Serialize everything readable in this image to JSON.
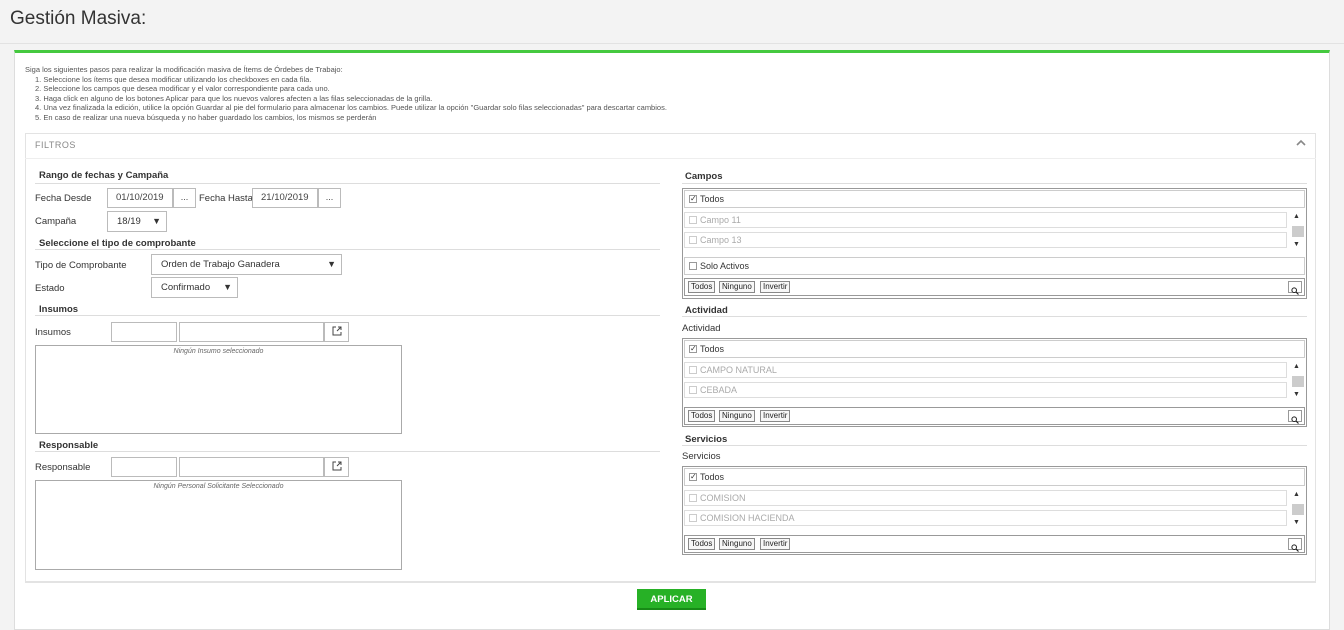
{
  "page": {
    "title": "Gestión Masiva:"
  },
  "instructions": {
    "intro": "Siga los siguientes pasos para realizar la modificación masiva de Ítems de Órdebes de Trabajo:",
    "steps": [
      "1. Seleccione los ítems que desea modificar utilizando los checkboxes en cada fila.",
      "2. Seleccione los campos que desea modificar y el valor correspondiente para cada uno.",
      "3. Haga click en alguno de los botones Aplicar para que los nuevos valores afecten a las filas seleccionadas de la grilla.",
      "4. Una vez finalizada la edición, utilice la opción Guardar al pie del formulario para almacenar los cambios. Puede utilizar la opción \"Guardar solo filas seleccionadas\" para descartar cambios.",
      "5. En caso de realizar una nueva búsqueda y no haber guardado los cambios, los mismos se perderán"
    ]
  },
  "filters": {
    "title": "FILTROS",
    "toggle_icon": "chevron-up-icon",
    "dates": {
      "section": "Rango de fechas y Campaña",
      "from_label": "Fecha Desde",
      "from_value": "01/10/2019",
      "to_label": "Fecha Hasta",
      "to_value": "21/10/2019",
      "picker_label": "...",
      "campaign_label": "Campaña",
      "campaign_value": "18/19"
    },
    "comprobante": {
      "section": "Seleccione el tipo de comprobante",
      "type_label": "Tipo de Comprobante",
      "type_value": "Orden de Trabajo Ganadera",
      "state_label": "Estado",
      "state_value": "Confirmado"
    },
    "insumos": {
      "section": "Insumos",
      "label": "Insumos",
      "code": "",
      "name": "",
      "empty_text": "Ningún Insumo seleccionado"
    },
    "responsable": {
      "section": "Responsable",
      "label": "Responsable",
      "code": "",
      "name": "",
      "empty_text": "Ningún Personal Solicitante Seleccionado"
    },
    "listbox_buttons": {
      "all": "Todos",
      "none": "Ninguno",
      "invert": "Invertir"
    },
    "campos": {
      "section": "Campos",
      "all_label": "Todos",
      "items": [
        "Campo 11",
        "Campo 13"
      ],
      "only_active": "Solo Activos"
    },
    "actividad": {
      "section": "Actividad",
      "label": "Actividad",
      "all_label": "Todos",
      "items": [
        "CAMPO NATURAL",
        "CEBADA"
      ]
    },
    "servicios": {
      "section": "Servicios",
      "label": "Servicios",
      "all_label": "Todos",
      "items": [
        "COMISION",
        "COMISION HACIENDA"
      ]
    }
  },
  "actions": {
    "apply": "APLICAR"
  },
  "colors": {
    "accent": "#45c93f",
    "apply_button": "#27b126"
  }
}
